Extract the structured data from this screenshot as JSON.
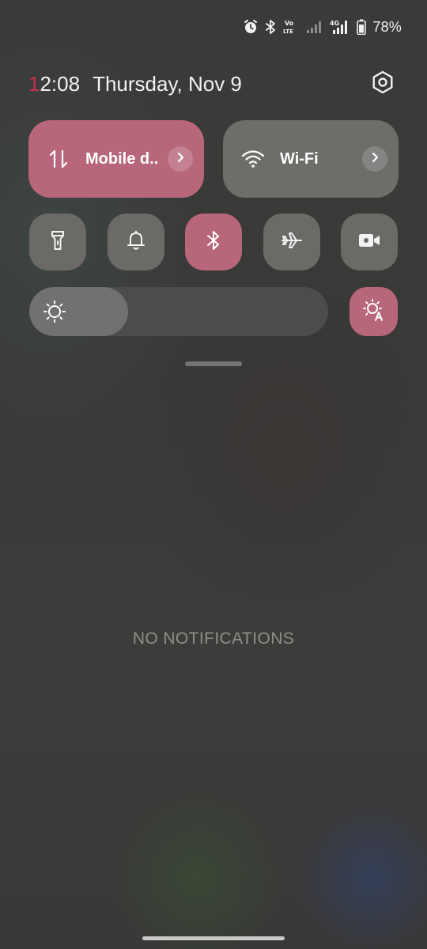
{
  "status_bar": {
    "icons": [
      "alarm-icon",
      "bluetooth-icon",
      "volte-icon",
      "signal-weak-icon",
      "signal-4g-icon",
      "battery-icon"
    ],
    "volte_label": "Vo\nLTE",
    "network_label": "4G",
    "battery": "78%"
  },
  "header": {
    "time_first_digit": "1",
    "time_rest": "2:08",
    "date": "Thursday, Nov 9",
    "settings_icon": "gear-icon"
  },
  "tiles": {
    "mobile_data": {
      "label": "Mobile d..",
      "icon": "data-transfer-icon",
      "active": true
    },
    "wifi": {
      "label": "Wi-Fi",
      "icon": "wifi-icon",
      "active": false
    }
  },
  "toggles": [
    {
      "name": "flashlight",
      "icon": "flashlight-icon",
      "active": false
    },
    {
      "name": "sound",
      "icon": "bell-icon",
      "active": false
    },
    {
      "name": "bluetooth",
      "icon": "bluetooth-icon",
      "active": true
    },
    {
      "name": "airplane-mode",
      "icon": "airplane-icon",
      "active": false
    },
    {
      "name": "screen-record",
      "icon": "video-camera-icon",
      "active": false
    }
  ],
  "brightness": {
    "level": 0.33,
    "icon": "sun-icon",
    "auto_icon": "auto-brightness-icon",
    "auto_enabled": true
  },
  "notifications": {
    "empty_text": "NO NOTIFICATIONS"
  },
  "colors": {
    "accent": "#b8667a",
    "tile_inactive": "#6e6d6a",
    "clock_accent": "#c9304a"
  }
}
